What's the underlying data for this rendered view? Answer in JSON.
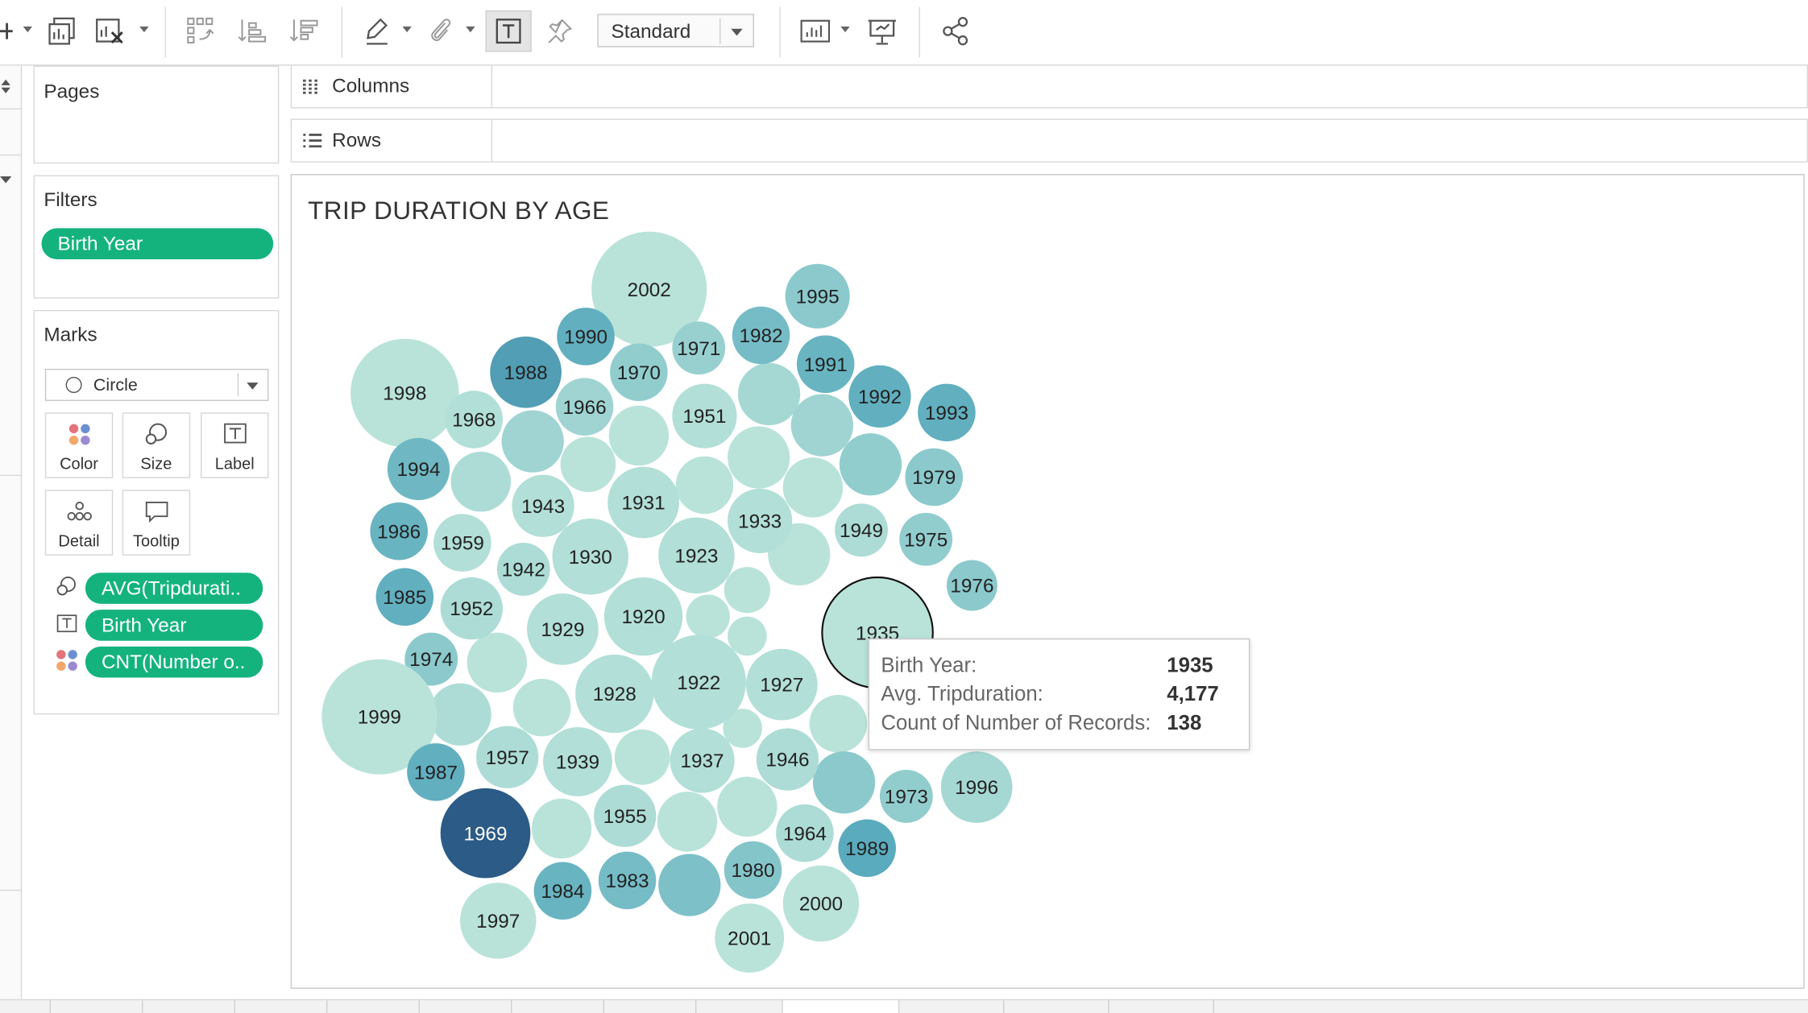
{
  "toolbar": {
    "fit_value": "Standard",
    "icons": [
      "new-sheet-icon",
      "duplicate-sheet-icon",
      "clear-sheet-icon",
      "swap-icon",
      "sort-ascending-icon",
      "sort-descending-icon",
      "highlight-icon",
      "group-icon",
      "show-labels-icon",
      "fix-axes-icon",
      "show-me-icon",
      "presentation-icon",
      "share-icon"
    ]
  },
  "cards": {
    "pages_title": "Pages",
    "filters_title": "Filters",
    "filter_pills": [
      "Birth Year"
    ],
    "marks_title": "Marks",
    "mark_type": "Circle",
    "mark_buttons": [
      "Color",
      "Size",
      "Label",
      "Detail",
      "Tooltip"
    ],
    "mark_pills": [
      "AVG(Tripdurati..",
      "Birth Year",
      "CNT(Number o.."
    ]
  },
  "shelves": {
    "columns_label": "Columns",
    "rows_label": "Rows"
  },
  "view": {
    "title": "TRIP DURATION BY AGE"
  },
  "tooltip": {
    "rows": [
      {
        "key": "Birth Year:",
        "value": "1935"
      },
      {
        "key": "Avg. Tripduration:",
        "value": "4,177"
      },
      {
        "key": "Count of Number of Records:",
        "value": "138"
      }
    ]
  },
  "colors": {
    "accent_pill": "#14b37d",
    "bubble_light": "#b9e3d9",
    "bubble_mid": "#8bc9cc",
    "bubble_strong": "#5aabbd",
    "bubble_darkest": "#2b5b86"
  },
  "chart_data": {
    "type": "packed-bubble",
    "title": "TRIP DURATION BY AGE",
    "size_measure": "AVG(Tripduration)",
    "label_field": "Birth Year",
    "color_measure": "CNT(Number of Records)",
    "highlighted": {
      "birth_year": "1935",
      "avg_tripduration": 4177,
      "count": 138
    },
    "bubbles": [
      {
        "label": "2002",
        "size": 1.6,
        "color": 0
      },
      {
        "label": "1995",
        "size": 0.9,
        "color": 0.35
      },
      {
        "label": "1990",
        "size": 0.8,
        "color": 0.65
      },
      {
        "label": "1971",
        "size": 0.75,
        "color": 0.25
      },
      {
        "label": "1982",
        "size": 0.8,
        "color": 0.5
      },
      {
        "label": "1988",
        "size": 1.0,
        "color": 0.75
      },
      {
        "label": "1970",
        "size": 0.8,
        "color": 0.3
      },
      {
        "label": "1991",
        "size": 0.8,
        "color": 0.6
      },
      {
        "label": "1998",
        "size": 1.5,
        "color": 0
      },
      {
        "label": "1968",
        "size": 0.8,
        "color": 0.05
      },
      {
        "label": "1966",
        "size": 0.8,
        "color": 0.2
      },
      {
        "label": "1951",
        "size": 0.9,
        "color": 0.05
      },
      {
        "label": "1992",
        "size": 0.85,
        "color": 0.65
      },
      {
        "label": "1993",
        "size": 0.8,
        "color": 0.65
      },
      {
        "label": "1994",
        "size": 0.85,
        "color": 0.55
      },
      {
        "label": "1979",
        "size": 0.8,
        "color": 0.35
      },
      {
        "label": "1943",
        "size": 0.85,
        "color": 0.05
      },
      {
        "label": "1931",
        "size": 1.0,
        "color": 0.05
      },
      {
        "label": "1933",
        "size": 0.9,
        "color": 0.05
      },
      {
        "label": "1949",
        "size": 0.75,
        "color": 0.1
      },
      {
        "label": "1986",
        "size": 0.8,
        "color": 0.6
      },
      {
        "label": "1959",
        "size": 0.8,
        "color": 0.05
      },
      {
        "label": "1975",
        "size": 0.75,
        "color": 0.3
      },
      {
        "label": "1942",
        "size": 0.75,
        "color": 0.1
      },
      {
        "label": "1930",
        "size": 1.05,
        "color": 0.05
      },
      {
        "label": "1923",
        "size": 1.05,
        "color": 0.05
      },
      {
        "label": "1976",
        "size": 0.7,
        "color": 0.35
      },
      {
        "label": "1985",
        "size": 0.8,
        "color": 0.65
      },
      {
        "label": "1952",
        "size": 0.85,
        "color": 0.1
      },
      {
        "label": "1929",
        "size": 1.0,
        "color": 0.05
      },
      {
        "label": "1920",
        "size": 1.1,
        "color": 0.05
      },
      {
        "label": "1935",
        "size": 1.55,
        "color": 0.05
      },
      {
        "label": "1974",
        "size": 0.75,
        "color": 0.35
      },
      {
        "label": "1928",
        "size": 1.1,
        "color": 0.05
      },
      {
        "label": "1922",
        "size": 1.3,
        "color": 0.05
      },
      {
        "label": "1927",
        "size": 1.0,
        "color": 0.05
      },
      {
        "label": "1999",
        "size": 1.6,
        "color": 0
      },
      {
        "label": "1957",
        "size": 0.85,
        "color": 0.1
      },
      {
        "label": "1939",
        "size": 0.95,
        "color": 0.05
      },
      {
        "label": "1937",
        "size": 0.9,
        "color": 0.05
      },
      {
        "label": "1946",
        "size": 0.85,
        "color": 0.1
      },
      {
        "label": "1987",
        "size": 0.8,
        "color": 0.65
      },
      {
        "label": "1996",
        "size": 1.0,
        "color": 0.15
      },
      {
        "label": "1973",
        "size": 0.75,
        "color": 0.3
      },
      {
        "label": "1969",
        "size": 1.25,
        "color": 1.0
      },
      {
        "label": "1955",
        "size": 0.85,
        "color": 0.1
      },
      {
        "label": "1964",
        "size": 0.8,
        "color": 0.1
      },
      {
        "label": "1989",
        "size": 0.8,
        "color": 0.7
      },
      {
        "label": "1984",
        "size": 0.8,
        "color": 0.6
      },
      {
        "label": "1983",
        "size": 0.8,
        "color": 0.5
      },
      {
        "label": "1980",
        "size": 0.8,
        "color": 0.4
      },
      {
        "label": "1997",
        "size": 1.05,
        "color": 0
      },
      {
        "label": "2000",
        "size": 1.05,
        "color": 0
      },
      {
        "label": "2001",
        "size": 0.95,
        "color": 0
      }
    ]
  }
}
